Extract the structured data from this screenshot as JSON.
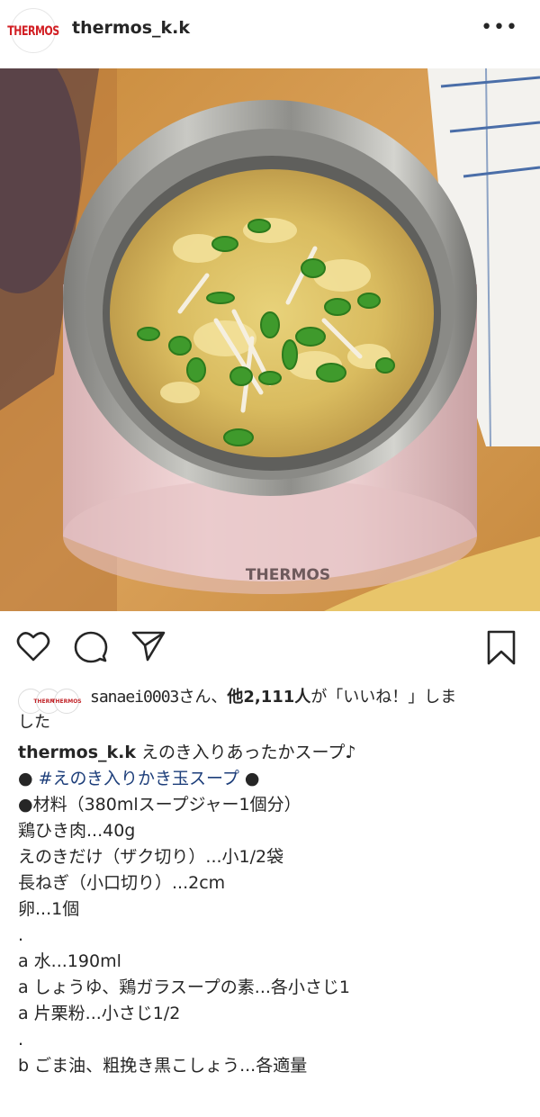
{
  "header": {
    "avatar_text": "THERMOS",
    "username": "thermos_k.k",
    "more_label": "•••"
  },
  "photo": {
    "product_label": "THERMOS"
  },
  "actions": {
    "like": "heart-icon",
    "comment": "comment-icon",
    "share": "send-icon",
    "save": "bookmark-icon"
  },
  "likes": {
    "liker": "sanaei0003",
    "mid": "さん、",
    "count_label": "他2,111人",
    "tail": "が「いいね！」しま",
    "tail2": "した",
    "avatar_text": "THERMOS"
  },
  "caption": {
    "username": "thermos_k.k",
    "title": " えのき入りあったかスープ♪",
    "bullet_open": "● ",
    "hashtag": "#えのき入りかき玉スープ",
    "bullet_close": " ●",
    "lines": [
      "●材料（380mlスープジャー1個分）",
      "鶏ひき肉...40g",
      "えのきだけ（ザク切り）...小1/2袋",
      "長ねぎ（小口切り）...2cm",
      "卵...1個",
      ".",
      "a 水...190ml",
      "a しょうゆ、鶏ガラスープの素...各小さじ1",
      "a 片栗粉...小さじ1/2",
      ".",
      "b ごま油、粗挽き黒こしょう...各適量"
    ]
  }
}
